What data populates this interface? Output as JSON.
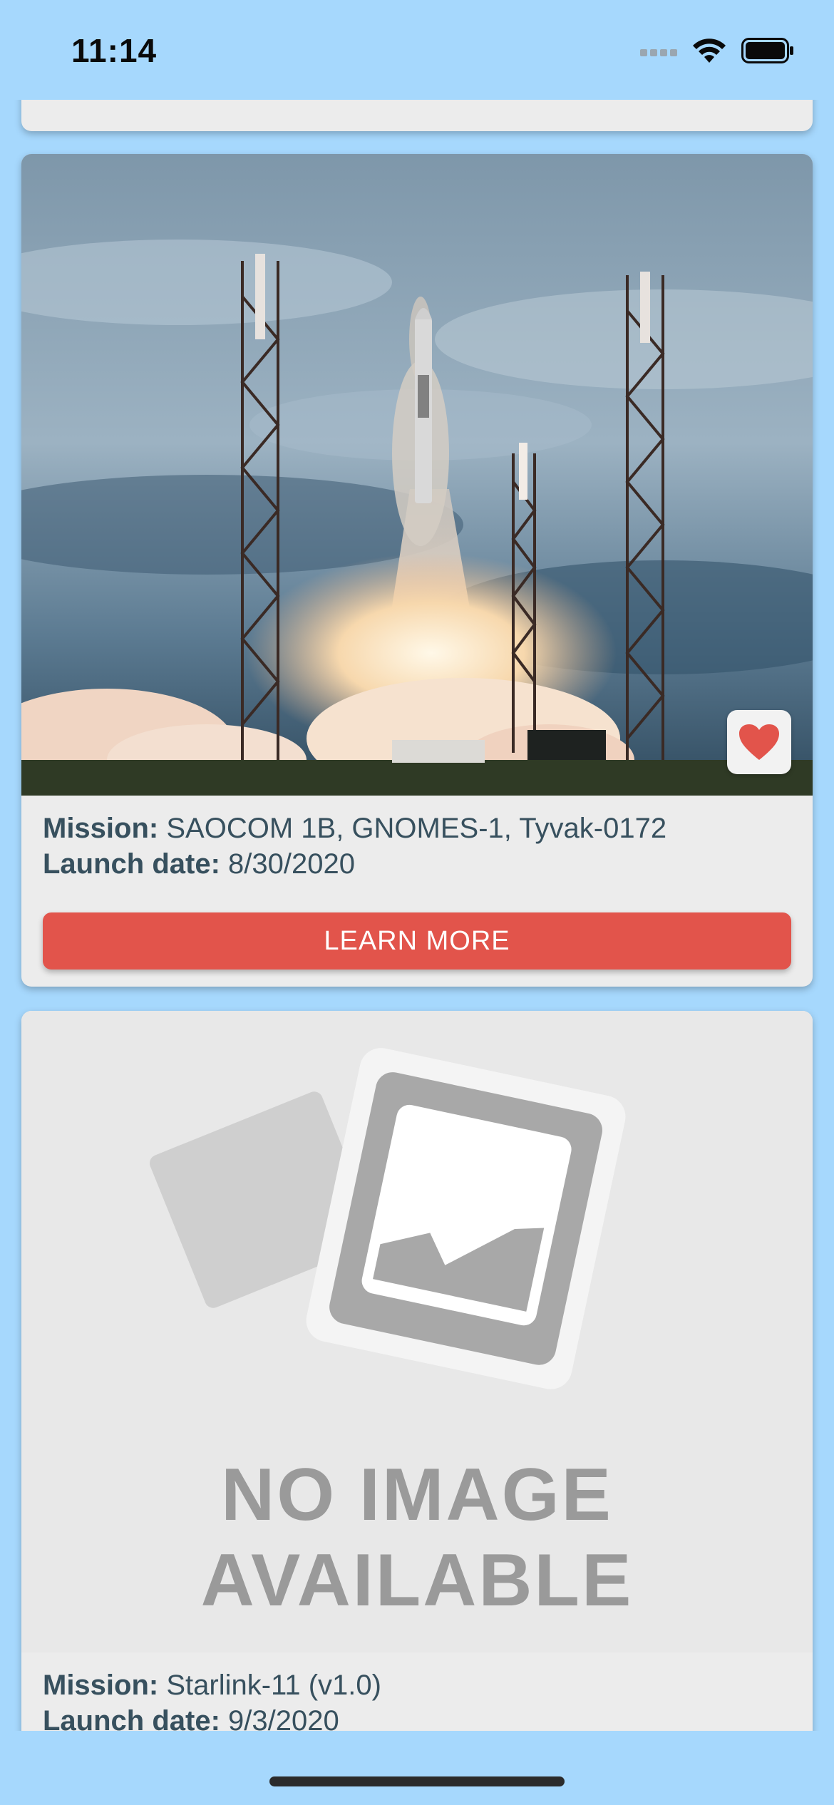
{
  "status": {
    "time": "11:14"
  },
  "previous_card": {
    "button_label": ""
  },
  "launches": [
    {
      "mission_label": "Mission:",
      "mission": "SAOCOM 1B, GNOMES-1, Tyvak-0172",
      "date_label": "Launch date:",
      "date": "8/30/2020",
      "button_label": "LEARN MORE",
      "favorite": true
    },
    {
      "mission_label": "Mission:",
      "mission": "Starlink-11 (v1.0)",
      "date_label": "Launch date:",
      "date": "9/3/2020",
      "placeholder_line1": "NO IMAGE",
      "placeholder_line2": "AVAILABLE"
    }
  ],
  "colors": {
    "background": "#a6d8fd",
    "button": "#e2544b",
    "heart": "#e2544b",
    "text": "#37505e"
  }
}
